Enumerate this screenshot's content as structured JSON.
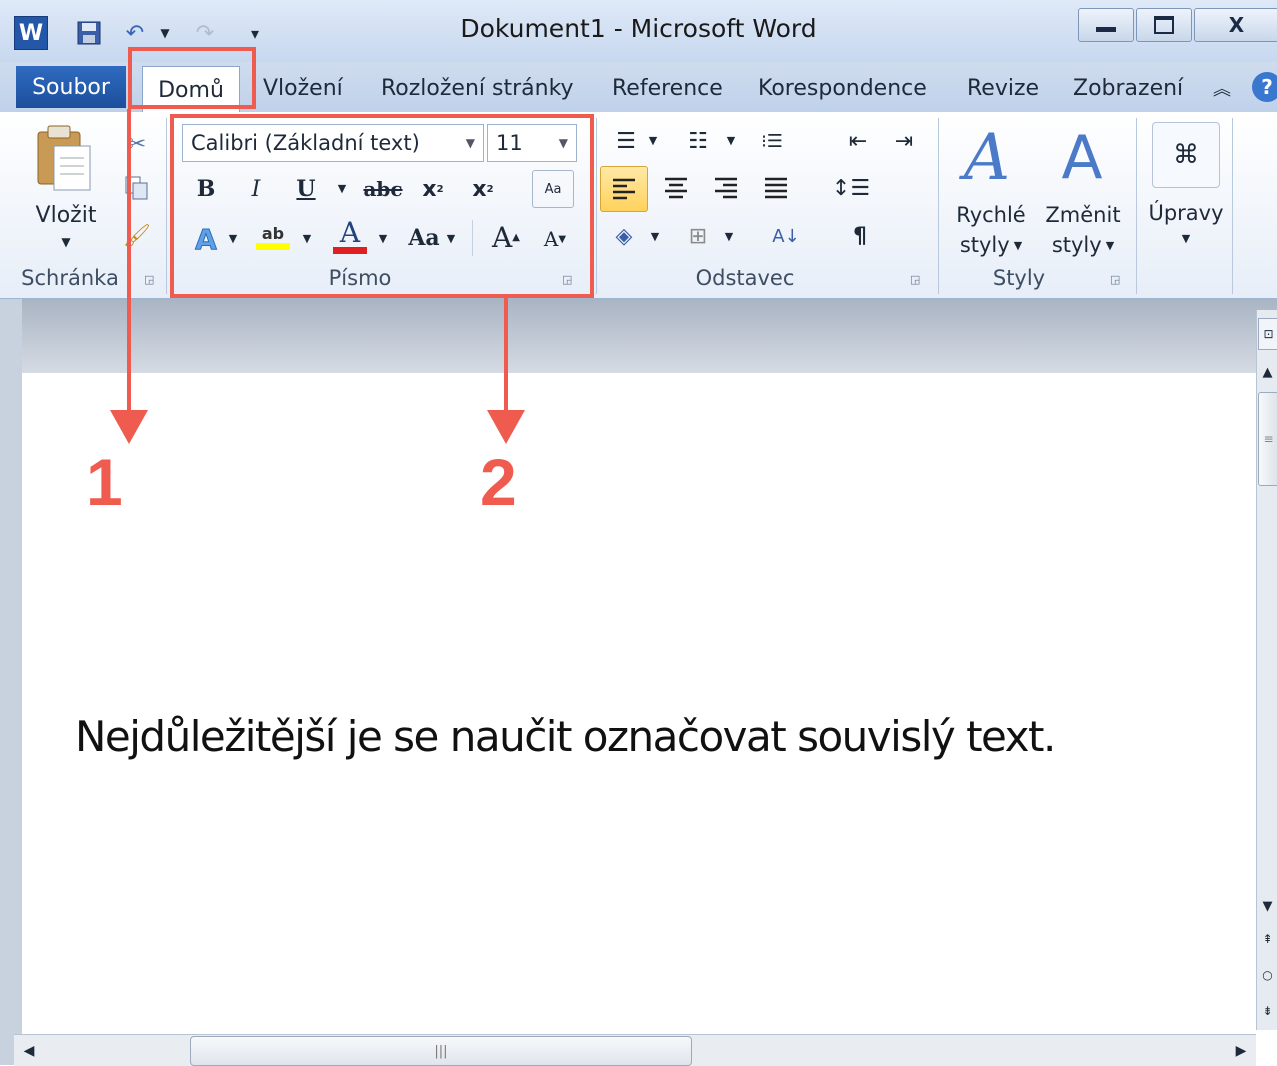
{
  "window": {
    "title": "Dokument1  -  Microsoft Word",
    "minimize_icon": "minimize-icon",
    "maximize_icon": "maximize-icon",
    "close_label": "X"
  },
  "quick_access": {
    "word_logo": "W",
    "save_icon": "save-icon",
    "undo_icon": "undo-icon",
    "redo_icon": "redo-icon",
    "customize_icon": "customize-icon"
  },
  "tabs": [
    "Soubor",
    "Domů",
    "Vložení",
    "Rozložení stránky",
    "Reference",
    "Korespondence",
    "Revize",
    "Zobrazení"
  ],
  "ribbon": {
    "clipboard": {
      "paste_label": "Vložit",
      "group_label": "Schránka"
    },
    "font": {
      "font_name": "Calibri (Základní text)",
      "font_size": "11",
      "group_label": "Písmo",
      "bold": "B",
      "italic": "I",
      "underline": "U",
      "strikethrough": "abc",
      "subscript": "x",
      "superscript": "x",
      "change_case": "Aa",
      "grow": "A",
      "shrink": "A",
      "font_color_letter": "A",
      "highlight_letters": "ab"
    },
    "paragraph": {
      "group_label": "Odstavec"
    },
    "styles": {
      "quick_line1": "Rychlé",
      "quick_line2": "styly",
      "change_line1": "Změnit",
      "change_line2": "styly",
      "group_label": "Styly"
    },
    "editing": {
      "label": "Úpravy"
    }
  },
  "document": {
    "text": "Nejdůležitější je se naučit označovat souvislý text."
  },
  "annotations": {
    "label_1": "1",
    "label_2": "2"
  },
  "colors": {
    "accent": "#ef5b4f",
    "file_tab": "#2457a8"
  }
}
